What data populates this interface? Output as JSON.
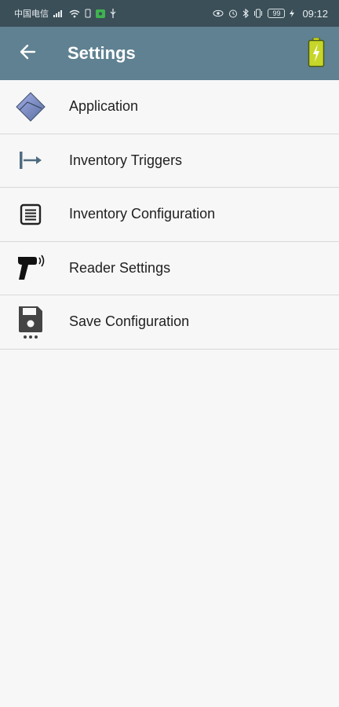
{
  "status_bar": {
    "carrier": "中国电信",
    "time": "09:12",
    "battery": "99"
  },
  "header": {
    "title": "Settings",
    "color": "#5f8191"
  },
  "menu": [
    {
      "label": "Application",
      "icon": "application-icon"
    },
    {
      "label": "Inventory Triggers",
      "icon": "trigger-icon"
    },
    {
      "label": "Inventory Configuration",
      "icon": "list-icon"
    },
    {
      "label": "Reader Settings",
      "icon": "scanner-icon"
    },
    {
      "label": "Save Configuration",
      "icon": "save-icon"
    }
  ]
}
